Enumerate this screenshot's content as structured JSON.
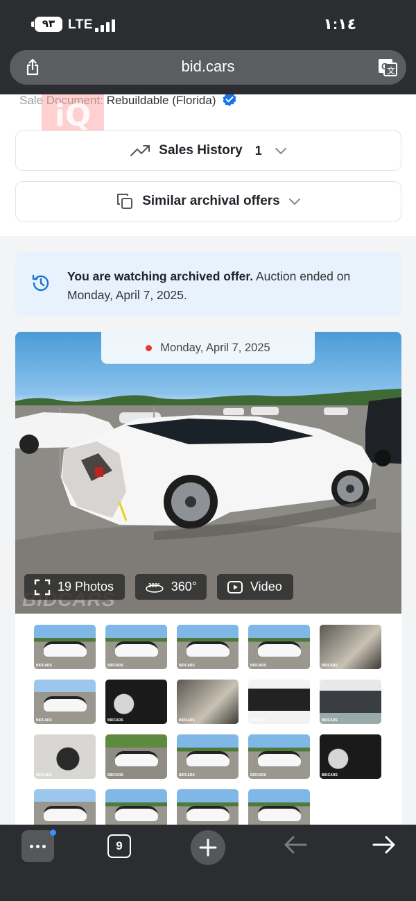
{
  "status_bar": {
    "battery": "٩٣",
    "network": "LTE",
    "time": "١:١٤"
  },
  "browser": {
    "url": "bid.cars",
    "tabs_count": "9"
  },
  "lot": {
    "sale_document_label": "Sale Document:",
    "sale_document_value": "Rebuildable (Florida)",
    "sales_history_label": "Sales History",
    "sales_history_count": "1",
    "similar_offers_label": "Similar archival offers"
  },
  "notice": {
    "bold": "You are watching archived offer.",
    "text": " Auction ended on Monday, April 7, 2025."
  },
  "gallery": {
    "date": "Monday, April 7, 2025",
    "photos_label": "19 Photos",
    "view360_label": "360°",
    "video_label": "Video",
    "watermark": "BIDCARS",
    "thumb_brand": "BIDCARS",
    "thumbnails": [
      {
        "kind": "exterior"
      },
      {
        "kind": "exterior"
      },
      {
        "kind": "exterior"
      },
      {
        "kind": "exterior"
      },
      {
        "kind": "interior"
      },
      {
        "kind": "rear"
      },
      {
        "kind": "gauges"
      },
      {
        "kind": "interior"
      },
      {
        "kind": "label"
      },
      {
        "kind": "engine"
      },
      {
        "kind": "key"
      },
      {
        "kind": "front"
      },
      {
        "kind": "exterior"
      },
      {
        "kind": "exterior"
      },
      {
        "kind": "gauges"
      },
      {
        "kind": "rear"
      },
      {
        "kind": "exterior"
      },
      {
        "kind": "exterior"
      },
      {
        "kind": "exterior"
      }
    ]
  },
  "colors": {
    "accent": "#1976d2",
    "notice_bg": "#e8f2fc",
    "chrome": "#2b2d30"
  }
}
